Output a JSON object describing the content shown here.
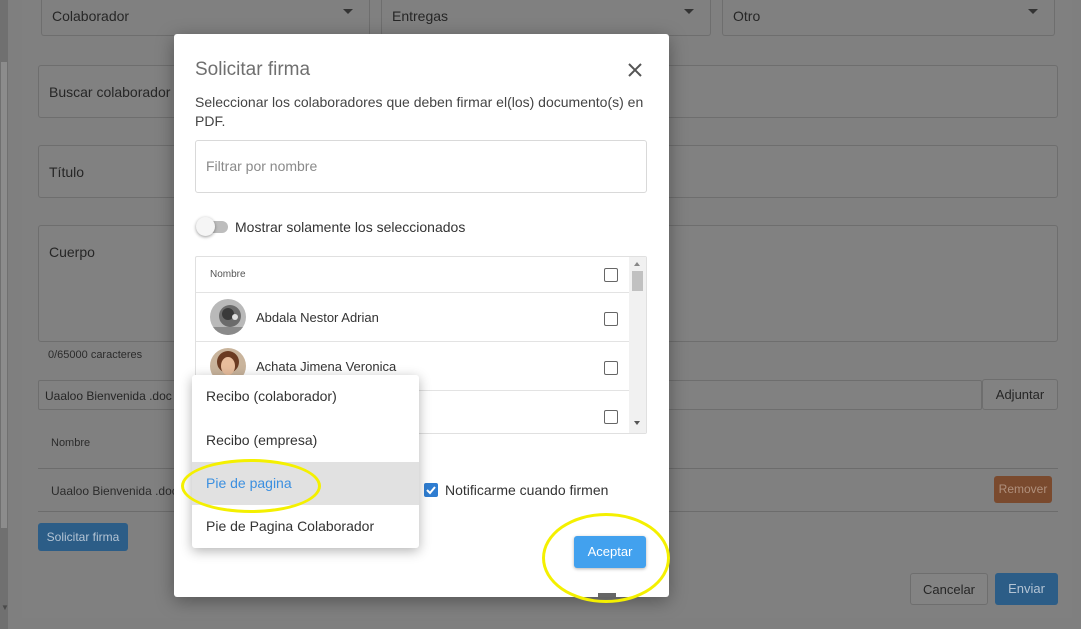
{
  "background": {
    "selects": [
      {
        "value": "Colaborador"
      },
      {
        "value": "Entregas"
      },
      {
        "value": "Otro"
      }
    ],
    "search_label": "Buscar colaborador",
    "title_label": "Título",
    "body_label": "Cuerpo",
    "char_count": "0/65000 caracteres",
    "attachment_input": "Uaaloo Bienvenida  .doc",
    "attach_button": "Adjuntar",
    "table_header": "Nombre",
    "table_row_name": "Uaaloo Bienvenida .doc",
    "remove_button": "Remover",
    "request_signature_button": "Solicitar firma",
    "cancel_button": "Cancelar",
    "send_button": "Enviar"
  },
  "modal": {
    "title": "Solicitar firma",
    "description": "Seleccionar los colaboradores que deben firmar el(los) documento(s) en PDF.",
    "filter_placeholder": "Filtrar por nombre",
    "toggle_label": "Mostrar solamente los seleccionados",
    "list_header": "Nombre",
    "collaborators": [
      {
        "name": "Abdala Nestor Adrian"
      },
      {
        "name": "Achata Jimena Veronica"
      },
      {
        "name": ""
      }
    ],
    "notify_label": "Notificarme cuando firmen",
    "accept_button": "Aceptar"
  },
  "dropdown": {
    "options": [
      {
        "label": "Recibo (colaborador)"
      },
      {
        "label": "Recibo (empresa)"
      },
      {
        "label": "Pie de pagina"
      },
      {
        "label": "Pie de Pagina Colaborador"
      }
    ],
    "selected": "Pie de pagina"
  },
  "colors": {
    "accent": "#42a1ee",
    "remove": "#c86432",
    "highlight": "#f4f000"
  }
}
